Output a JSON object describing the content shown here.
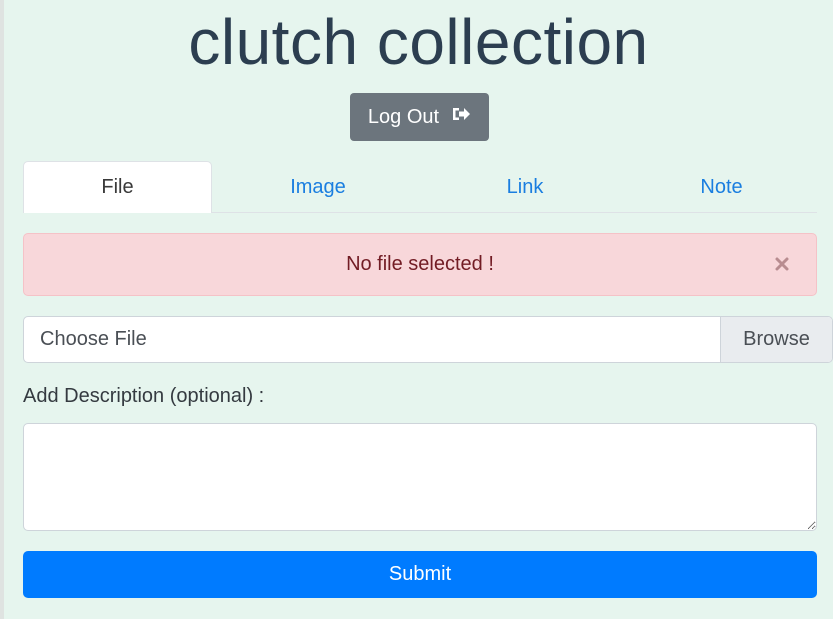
{
  "app": {
    "title": "clutch collection"
  },
  "header": {
    "logout_label": "Log Out",
    "logout_icon": "sign-out-icon"
  },
  "tabs": [
    {
      "label": "File",
      "active": true
    },
    {
      "label": "Image",
      "active": false
    },
    {
      "label": "Link",
      "active": false
    },
    {
      "label": "Note",
      "active": false
    }
  ],
  "alert": {
    "message": "No file selected !",
    "close_icon": "close-icon"
  },
  "upload": {
    "placeholder": "Choose File",
    "browse_label": "Browse"
  },
  "description": {
    "label": "Add Description (optional) :",
    "value": ""
  },
  "form": {
    "submit_label": "Submit"
  },
  "colors": {
    "background": "#e6f5ee",
    "title": "#2c3e50",
    "logout_button": "#6c757d",
    "tab_link": "#1a7ee0",
    "alert_bg": "#f8d7da",
    "alert_text": "#721c24",
    "submit_button": "#007bff"
  }
}
